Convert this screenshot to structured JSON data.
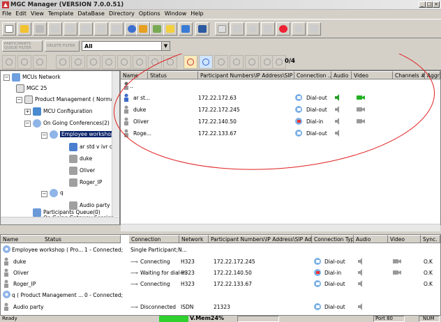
{
  "window": {
    "title": "MGC Manager (VERSION 7.0.0.51)",
    "min": "_",
    "max": "□",
    "close": "×"
  },
  "menu": [
    "File",
    "Edit",
    "View",
    "Template",
    "DataBase",
    "Directory",
    "Options",
    "Window",
    "Help"
  ],
  "filter": {
    "participants_label": "PARTICIPANTS QUEUE FILTER",
    "delete_label": "DELETE FILTER",
    "value": "All",
    "dropdown_icon": "▼"
  },
  "counter": "0/4",
  "tree": {
    "items": [
      {
        "label": "MCUs Network",
        "icon": "network-icon"
      },
      {
        "label": "MGC 25",
        "icon": "mcu-icon"
      },
      {
        "label": "Product Management  ( Norma",
        "icon": "mcu-icon"
      },
      {
        "label": "MCU Configuration",
        "icon": "config-icon"
      },
      {
        "label": "On Going Conferences(2)",
        "icon": "conference-icon"
      },
      {
        "label": "Employee workshop",
        "icon": "conference-icon"
      },
      {
        "label": "ar std v ivr o",
        "icon": "person-icon"
      },
      {
        "label": "duke",
        "icon": "person-icon"
      },
      {
        "label": "Oliver",
        "icon": "person-icon"
      },
      {
        "label": "Roger_IP",
        "icon": "person-icon"
      },
      {
        "label": "q",
        "icon": "conference-icon"
      },
      {
        "label": "Audio party",
        "icon": "person-icon"
      },
      {
        "label": "On Going Gateway Session",
        "icon": "gateway-icon"
      },
      {
        "label": "Participants Queue(0)",
        "icon": "queue-icon"
      },
      {
        "label": "Reservations(0)",
        "icon": "reservation-icon"
      }
    ],
    "expand_sign": "+",
    "collapse_sign": "−"
  },
  "grid": {
    "columns": [
      "Name",
      "Status",
      "Participant Numbers\\IP Address\\SIP Address",
      "Connection ...",
      "Audio",
      "Video",
      "Channels #",
      "Aggregation"
    ],
    "rows": [
      {
        "name": "..",
        "ip": "",
        "conn": "",
        "audio": "",
        "video": ""
      },
      {
        "name": "ar st...",
        "ip": "172.22.172.63",
        "conn": "Dial-out",
        "audio": "active",
        "video": "active"
      },
      {
        "name": "duke",
        "ip": "172.22.172.245",
        "conn": "Dial-out",
        "audio": "muted",
        "video": "inactive"
      },
      {
        "name": "Oliver",
        "ip": "172.22.140.50",
        "conn": "Dial-in",
        "audio": "muted",
        "video": "inactive"
      },
      {
        "name": "Roge...",
        "ip": "172.22.133.67",
        "conn": "Dial-out",
        "audio": "muted",
        "video": ""
      }
    ]
  },
  "bottom": {
    "columns": [
      "Name",
      "Status",
      "Connection",
      "Network",
      "Participant Numbers\\IP Address\\SIP Address",
      "Connection Type",
      "Audio",
      "Video",
      "Sync."
    ],
    "rows": [
      {
        "name": "Employee workshop ( Pro...",
        "status": "1 - Connected;",
        "connection": "Single Participant;N...",
        "network": "",
        "ip": "",
        "type": "",
        "sync": "",
        "kind": "conference"
      },
      {
        "name": "duke",
        "status": "",
        "connection": "Connecting",
        "network": "H323",
        "ip": "172.22.172.245",
        "type": "Dial-out",
        "sync": "O.K",
        "kind": "person"
      },
      {
        "name": "Oliver",
        "status": "",
        "connection": "Waiting for dial-in",
        "network": "H323",
        "ip": "172.22.140.50",
        "type": "Dial-in",
        "sync": "O.K",
        "kind": "person"
      },
      {
        "name": "Roger_IP",
        "status": "",
        "connection": "Connecting",
        "network": "H323",
        "ip": "172.22.133.67",
        "type": "Dial-out",
        "sync": "O.K",
        "kind": "person"
      },
      {
        "name": "q ( Product Management ...",
        "status": "0 - Connected;",
        "connection": "",
        "network": "",
        "ip": "",
        "type": "",
        "sync": "",
        "kind": "conference"
      },
      {
        "name": "Audio party",
        "status": "",
        "connection": "Disconnected",
        "network": "ISDN",
        "ip": "21323",
        "type": "Dial-out",
        "sync": "",
        "kind": "person"
      }
    ]
  },
  "status": {
    "ready": "Ready",
    "mem": "V.Mem24%",
    "port": "Port 80",
    "num": "NUM"
  },
  "colors": {
    "accent": "#0a246a",
    "annotation": "#e02020",
    "mem_green": "#2fd12f"
  }
}
